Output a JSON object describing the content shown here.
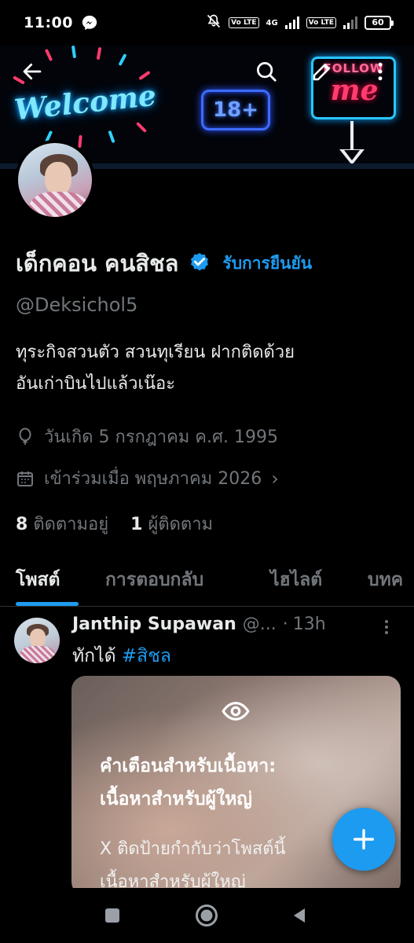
{
  "status_bar": {
    "time": "11:00",
    "volte1": "Vo LTE",
    "network": "4G",
    "volte2": "Vo LTE",
    "battery": "60"
  },
  "banner": {
    "welcome_text": "Welcome",
    "badge_text": "18+",
    "follow_text": "FOLLOW",
    "me_text": "me"
  },
  "profile": {
    "name": "เด็กคอน คนสิชล",
    "verify_label": "รับการยืนยัน",
    "handle": "@Deksichol5",
    "bio_line1": "ทุระกิจสวนตัว สวนทุเรียน ฝากติดด้วย",
    "bio_line2": "อันเก่าบินไปแล้วเน๊อะ",
    "birthday": "วันเกิด 5 กรกฎาคม ค.ศ. 1995",
    "joined": "เข้าร่วมเมื่อ พฤษภาคม 2026",
    "following_count": "8",
    "following_label": "ติดตามอยู่",
    "followers_count": "1",
    "followers_label": "ผู้ติดตาม"
  },
  "tabs": [
    {
      "label": "โพสต์",
      "active": true
    },
    {
      "label": "การตอบกลับ",
      "active": false
    },
    {
      "label": "ไฮไลต์",
      "active": false
    },
    {
      "label": "บทค",
      "active": false
    }
  ],
  "post": {
    "author": "Janthip Supawan",
    "handle": "@...",
    "dot": "·",
    "time": "13h",
    "text": "ทักได้",
    "hashtag": "#สิชล",
    "warning_title_line1": "คำเตือนสำหรับเนื้อหา:",
    "warning_title_line2": "เนื้อหาสำหรับผู้ใหญ่",
    "warning_body_line1": "X ติดป้ายกำกับว่าโพสต์นี้",
    "warning_body_line2": "เนื้อหาสำหรับผู้ใหญ่"
  },
  "colors": {
    "accent": "#1d9bf0",
    "text_primary": "#e7e9ea",
    "text_secondary": "#71767b",
    "background": "#000000"
  },
  "icons": {
    "back": "arrow-left-icon",
    "search": "search-icon",
    "edit": "pencil-icon",
    "more": "more-vertical-icon",
    "verified": "verified-badge-icon",
    "birthday": "balloon-icon",
    "joined": "calendar-icon",
    "sensitive": "eye-icon",
    "compose": "plus-icon"
  }
}
